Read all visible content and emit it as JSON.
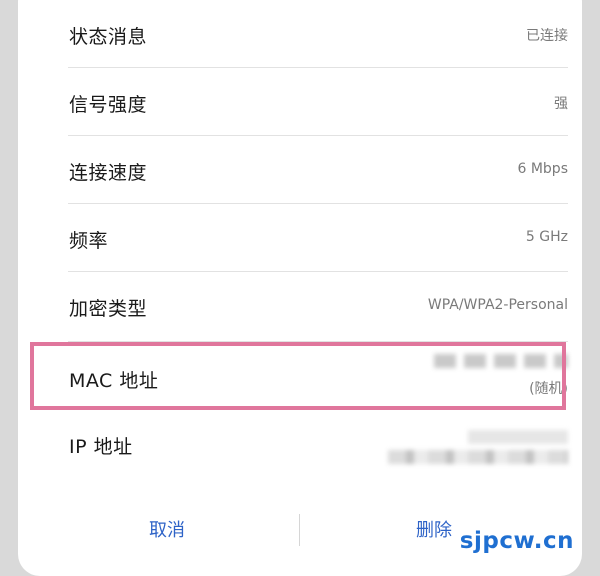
{
  "rows": {
    "status": {
      "label": "状态消息",
      "value": "已连接"
    },
    "signal": {
      "label": "信号强度",
      "value": "强"
    },
    "speed": {
      "label": "连接速度",
      "value": "6 Mbps"
    },
    "frequency": {
      "label": "频率",
      "value": "5 GHz"
    },
    "encryption": {
      "label": "加密类型",
      "value": "WPA/WPA2-Personal"
    },
    "mac": {
      "label": "MAC 地址",
      "value_note": "(随机)"
    },
    "ip": {
      "label": "IP 地址"
    }
  },
  "actions": {
    "cancel": "取消",
    "delete": "删除"
  },
  "watermark": "sjpcw.cn",
  "colors": {
    "accent": "#2e63c7",
    "highlight": "#e0769c",
    "watermark": "#1f6fd1"
  }
}
